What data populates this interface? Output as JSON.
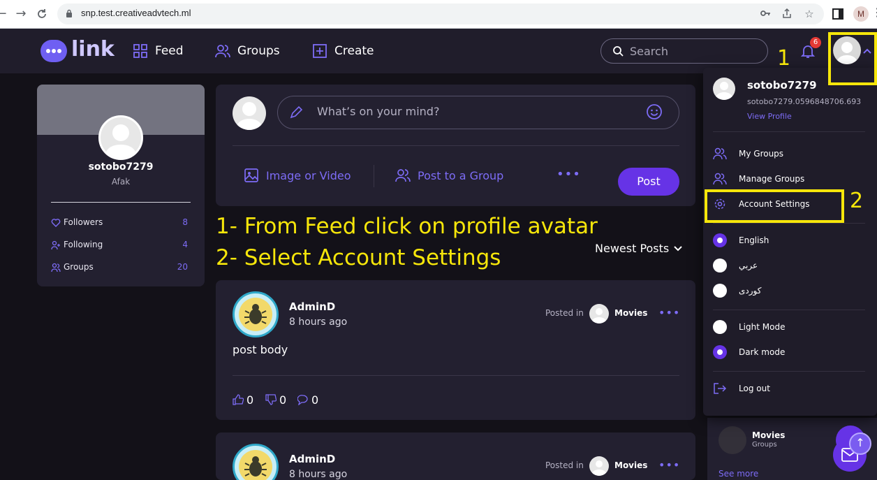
{
  "browser": {
    "url": "snp.test.creativeadvtech.ml",
    "profile_initial": "M"
  },
  "header": {
    "logo_text": "link",
    "nav": [
      {
        "label": "Feed"
      },
      {
        "label": "Groups"
      },
      {
        "label": "Create"
      }
    ],
    "search_placeholder": "Search",
    "notification_count": "6"
  },
  "annotations": {
    "num1": "1",
    "num2": "2",
    "step1": "1- From Feed click on profile avatar",
    "step2": "2- Select Account Settings"
  },
  "profile_card": {
    "username": "sotobo7279",
    "name": "Afak",
    "stats": [
      {
        "label": "Followers",
        "count": "8"
      },
      {
        "label": "Following",
        "count": "4"
      },
      {
        "label": "Groups",
        "count": "20"
      }
    ]
  },
  "composer": {
    "placeholder": "What’s on your mind?",
    "image_video": "Image or Video",
    "post_to_group": "Post to a Group",
    "more": "•••",
    "post_button": "Post"
  },
  "feed": {
    "sort_label": "Newest Posts",
    "posts": [
      {
        "author": "AdminD",
        "time": "8 hours ago",
        "posted_in": "Posted in",
        "group": "Movies",
        "body": "post body",
        "likes": "0",
        "dislikes": "0",
        "comments": "0"
      },
      {
        "author": "AdminD",
        "time": "8 hours ago",
        "posted_in": "Posted in",
        "group": "Movies"
      }
    ]
  },
  "dropdown": {
    "username": "sotobo7279",
    "email": "sotobo7279.0596848706.693",
    "view_profile": "View Profile",
    "items": [
      {
        "label": "My Groups"
      },
      {
        "label": "Manage Groups"
      },
      {
        "label": "Account Settings"
      }
    ],
    "languages": [
      {
        "label": "English",
        "selected": true
      },
      {
        "label": "عربي",
        "selected": false
      },
      {
        "label": "كوردی",
        "selected": false
      }
    ],
    "modes": [
      {
        "label": "Light Mode",
        "selected": false
      },
      {
        "label": "Dark mode",
        "selected": true
      }
    ],
    "logout": "Log out"
  },
  "right_panel": {
    "group_name": "Movies",
    "group_type": "Groups",
    "see_more": "See more"
  },
  "colors": {
    "accent": "#6633e6",
    "accent_text": "#7d6cf6",
    "annotation": "#f6e60a",
    "background": "#131118",
    "card": "#232030"
  }
}
